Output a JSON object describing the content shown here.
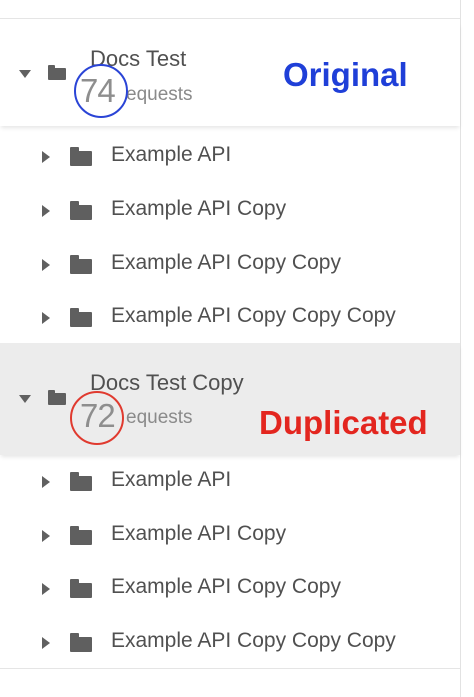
{
  "collections": [
    {
      "name": "Docs Test",
      "sub_label": "equests",
      "count": "74",
      "tag": "Original",
      "tag_color": "#1f3fd8",
      "items": [
        "Example API",
        "Example API Copy",
        "Example API Copy Copy",
        "Example API Copy Copy Copy"
      ]
    },
    {
      "name": "Docs Test Copy",
      "sub_label": "equests",
      "count": "72",
      "tag": "Duplicated",
      "tag_color": "#e3261f",
      "items": [
        "Example API",
        "Example API Copy",
        "Example API Copy Copy",
        "Example API Copy Copy Copy"
      ]
    }
  ],
  "icons": {
    "collapse": "caret-down-icon",
    "expand": "caret-right-icon",
    "folder": "folder-icon"
  }
}
